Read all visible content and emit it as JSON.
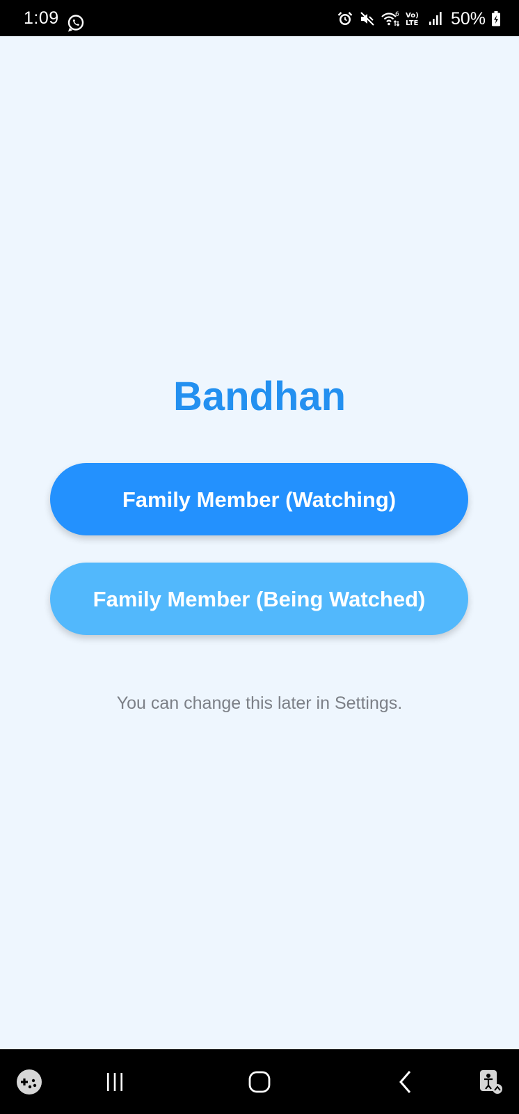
{
  "status_bar": {
    "time": "1:09",
    "battery_percent": "50%",
    "icons": [
      "whatsapp-icon",
      "alarm-icon",
      "mute-icon",
      "wifi-icon",
      "volte-icon",
      "signal-icon",
      "battery-icon"
    ]
  },
  "app": {
    "title": "Bandhan"
  },
  "buttons": {
    "watching_label": "Family Member (Watching)",
    "being_watched_label": "Family Member (Being Watched)"
  },
  "hint": "You can change this later in Settings.",
  "colors": {
    "background": "#EEF6FE",
    "title": "#2390F0",
    "primary_button": "#2391FE",
    "secondary_button": "#52B8FC",
    "hint_text": "#7C8087"
  },
  "nav_bar": {
    "icons": [
      "game-launcher-icon",
      "recent-apps-icon",
      "home-icon",
      "back-icon",
      "accessibility-icon"
    ]
  }
}
